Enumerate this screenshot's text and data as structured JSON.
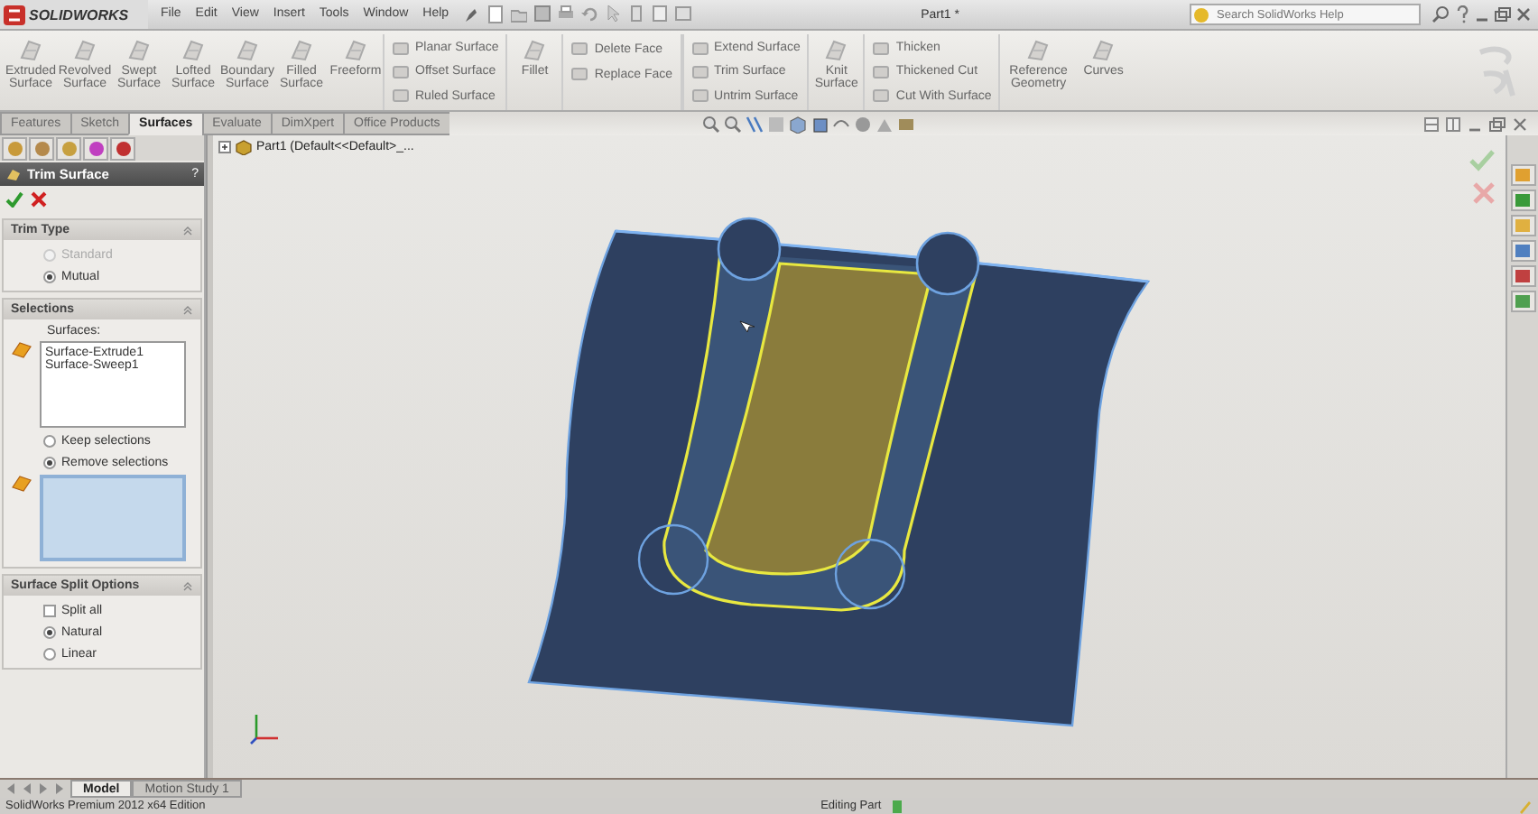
{
  "title_bar": {
    "logo": "SOLIDWORKS",
    "menu": [
      "File",
      "Edit",
      "View",
      "Insert",
      "Tools",
      "Window",
      "Help"
    ],
    "title": "Part1 *",
    "search": {
      "placeholder": "Search SolidWorks Help"
    }
  },
  "ribbon": {
    "groups": [
      {
        "kind": "large",
        "label": "Extruded Surface"
      },
      {
        "kind": "large",
        "label": "Revolved Surface"
      },
      {
        "kind": "large",
        "label": "Swept Surface"
      },
      {
        "kind": "large",
        "label": "Lofted Surface"
      },
      {
        "kind": "large",
        "label": "Boundary Surface"
      },
      {
        "kind": "large",
        "label": "Filled Surface"
      },
      {
        "kind": "large",
        "label": "Freeform"
      },
      {
        "kind": "stack",
        "items": [
          "Planar Surface",
          "Offset Surface",
          "Ruled Surface"
        ]
      },
      {
        "kind": "large",
        "label": "Fillet"
      },
      {
        "kind": "stack",
        "items": [
          "Delete Face",
          "Replace Face"
        ]
      },
      {
        "kind": "stack",
        "items": [
          "Extend Surface",
          "Trim Surface",
          "Untrim Surface"
        ]
      },
      {
        "kind": "large",
        "label": "Knit Surface"
      },
      {
        "kind": "stack",
        "items": [
          "Thicken",
          "Thickened Cut",
          "Cut With Surface"
        ]
      },
      {
        "kind": "large",
        "label": "Reference Geometry"
      },
      {
        "kind": "large",
        "label": "Curves"
      }
    ]
  },
  "command_tabs": [
    {
      "label": "Features",
      "selected": false
    },
    {
      "label": "Sketch",
      "selected": false
    },
    {
      "label": "Surfaces",
      "selected": true
    },
    {
      "label": "Evaluate",
      "selected": false
    },
    {
      "label": "DimXpert",
      "selected": false
    },
    {
      "label": "Office Products",
      "selected": false
    }
  ],
  "property_manager": {
    "title": "Trim Surface",
    "help": "?",
    "sections": [
      {
        "title": "Trim Type",
        "rows": [
          {
            "kind": "radio",
            "label": "Standard",
            "selected": false,
            "disabled": true
          },
          {
            "kind": "radio",
            "label": "Mutual",
            "selected": true,
            "disabled": false
          }
        ]
      },
      {
        "title": "Selections",
        "rows": [
          {
            "kind": "list",
            "label": "Surfaces:",
            "items": [
              "Surface-Extrude1",
              "Surface-Sweep1"
            ]
          },
          {
            "kind": "radio",
            "label": "Keep selections",
            "selected": false
          },
          {
            "kind": "radio",
            "label": "Remove selections",
            "selected": true
          },
          {
            "kind": "list"
          }
        ]
      },
      {
        "title": "Surface Split Options",
        "rows": [
          {
            "kind": "checkbox",
            "label": "Split all",
            "checked": false
          },
          {
            "kind": "radio",
            "label": "Natural",
            "selected": true
          },
          {
            "kind": "radio",
            "label": "Linear",
            "selected": false
          }
        ]
      }
    ]
  },
  "viewport": {
    "tree_label": "Part1  (Default<<Default>_..."
  },
  "bottom_tabs": [
    {
      "label": "Model",
      "selected": true
    },
    {
      "label": "Motion Study 1",
      "selected": false
    }
  ],
  "status_bar": {
    "edition": "SolidWorks Premium 2012 x64 Edition",
    "mode": "Editing Part"
  }
}
